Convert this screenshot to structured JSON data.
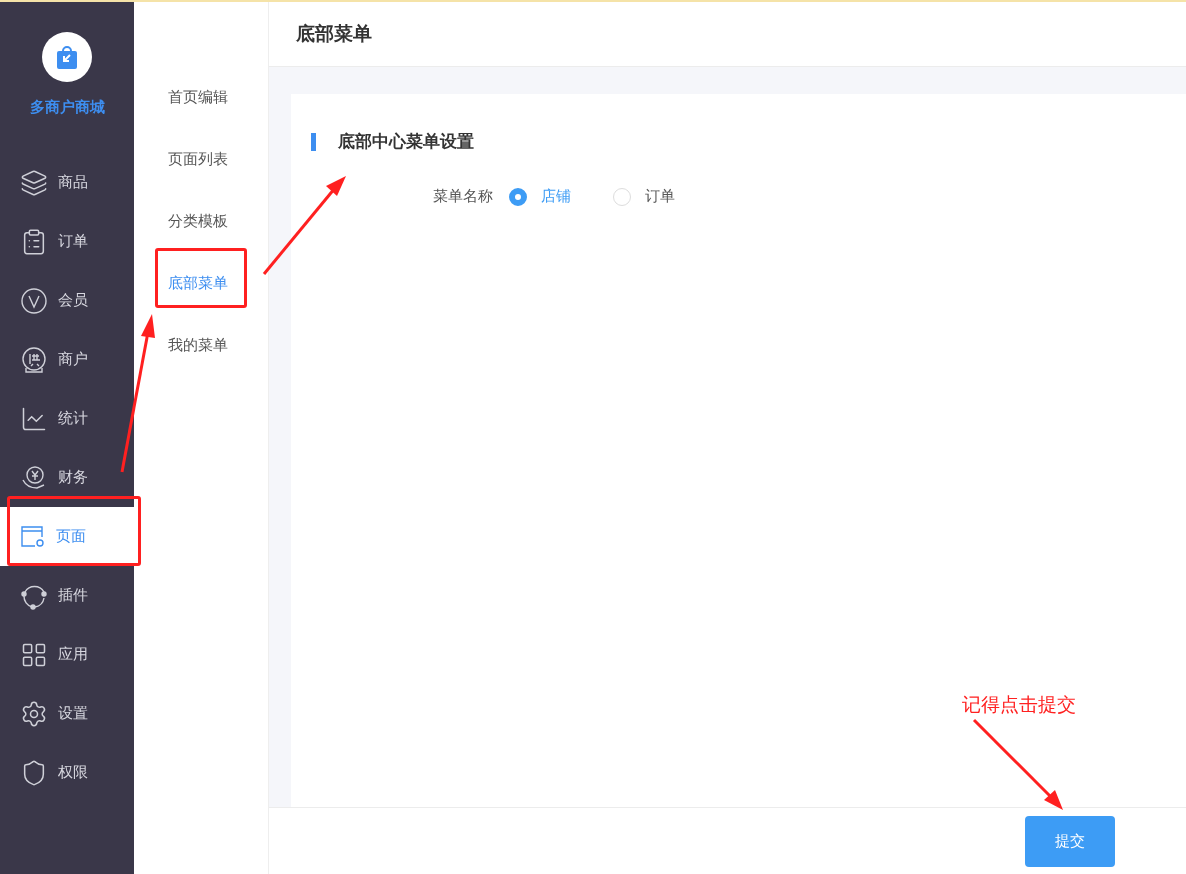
{
  "brand": {
    "name": "多商户商城"
  },
  "sidebar": {
    "items": [
      {
        "label": "商品",
        "selected": false
      },
      {
        "label": "订单",
        "selected": false
      },
      {
        "label": "会员",
        "selected": false
      },
      {
        "label": "商户",
        "selected": false
      },
      {
        "label": "统计",
        "selected": false
      },
      {
        "label": "财务",
        "selected": false
      },
      {
        "label": "页面",
        "selected": true
      },
      {
        "label": "插件",
        "selected": false
      },
      {
        "label": "应用",
        "selected": false
      },
      {
        "label": "设置",
        "selected": false
      },
      {
        "label": "权限",
        "selected": false
      }
    ]
  },
  "subnav": {
    "items": [
      {
        "label": "首页编辑",
        "selected": false
      },
      {
        "label": "页面列表",
        "selected": false
      },
      {
        "label": "分类模板",
        "selected": false
      },
      {
        "label": "底部菜单",
        "selected": true
      },
      {
        "label": "我的菜单",
        "selected": false
      }
    ]
  },
  "page": {
    "title": "底部菜单"
  },
  "section": {
    "title": "底部中心菜单设置"
  },
  "form": {
    "label": "菜单名称",
    "options": [
      {
        "label": "店铺",
        "selected": true
      },
      {
        "label": "订单",
        "selected": false
      }
    ]
  },
  "footer": {
    "submit": "提交"
  },
  "annotation": {
    "note": "记得点击提交"
  }
}
